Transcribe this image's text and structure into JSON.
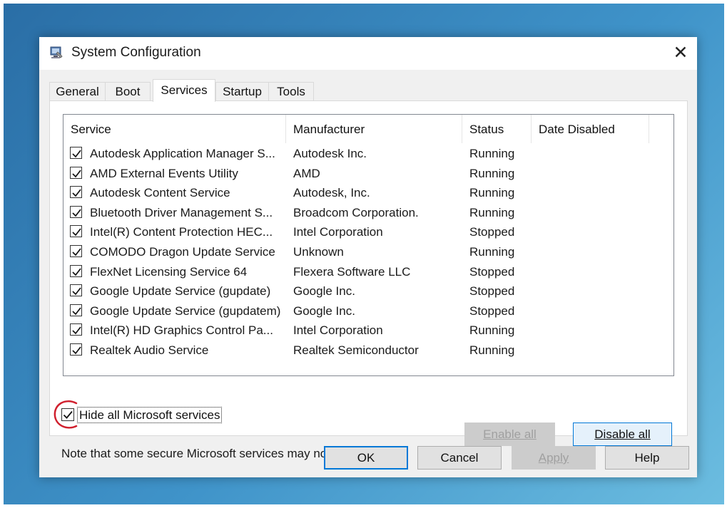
{
  "window": {
    "title": "System Configuration",
    "icon": "msconfig-icon",
    "close_icon": "close-icon"
  },
  "tabs": [
    {
      "label": "General"
    },
    {
      "label": "Boot"
    },
    {
      "label": "Services",
      "active": true
    },
    {
      "label": "Startup"
    },
    {
      "label": "Tools"
    }
  ],
  "services": {
    "columns": [
      "Service",
      "Manufacturer",
      "Status",
      "Date Disabled"
    ],
    "rows": [
      {
        "service": "Autodesk Application Manager S...",
        "manufacturer": "Autodesk Inc.",
        "status": "Running",
        "date_disabled": "",
        "checked": true
      },
      {
        "service": "AMD External Events Utility",
        "manufacturer": "AMD",
        "status": "Running",
        "date_disabled": "",
        "checked": true
      },
      {
        "service": "Autodesk Content Service",
        "manufacturer": "Autodesk, Inc.",
        "status": "Running",
        "date_disabled": "",
        "checked": true
      },
      {
        "service": "Bluetooth Driver Management S...",
        "manufacturer": "Broadcom Corporation.",
        "status": "Running",
        "date_disabled": "",
        "checked": true
      },
      {
        "service": "Intel(R) Content Protection HEC...",
        "manufacturer": "Intel Corporation",
        "status": "Stopped",
        "date_disabled": "",
        "checked": true
      },
      {
        "service": "COMODO Dragon Update Service",
        "manufacturer": "Unknown",
        "status": "Running",
        "date_disabled": "",
        "checked": true
      },
      {
        "service": "FlexNet Licensing Service 64",
        "manufacturer": "Flexera Software LLC",
        "status": "Stopped",
        "date_disabled": "",
        "checked": true
      },
      {
        "service": "Google Update Service (gupdate)",
        "manufacturer": "Google Inc.",
        "status": "Stopped",
        "date_disabled": "",
        "checked": true
      },
      {
        "service": "Google Update Service (gupdatem)",
        "manufacturer": "Google Inc.",
        "status": "Stopped",
        "date_disabled": "",
        "checked": true
      },
      {
        "service": "Intel(R) HD Graphics Control Pa...",
        "manufacturer": "Intel Corporation",
        "status": "Running",
        "date_disabled": "",
        "checked": true
      },
      {
        "service": "Realtek Audio Service",
        "manufacturer": "Realtek Semiconductor",
        "status": "Running",
        "date_disabled": "",
        "checked": true
      }
    ]
  },
  "note": "Note that some secure Microsoft services may not be disabled.",
  "enable_all_label": "Enable all",
  "disable_all_label": "Disable all",
  "hide_microsoft": {
    "label": "Hide all Microsoft services",
    "checked": true
  },
  "footer": {
    "ok_label": "OK",
    "cancel_label": "Cancel",
    "apply_label": "Apply",
    "help_label": "Help"
  },
  "colors": {
    "accent": "#0078d7",
    "annotation": "#d0202e"
  }
}
